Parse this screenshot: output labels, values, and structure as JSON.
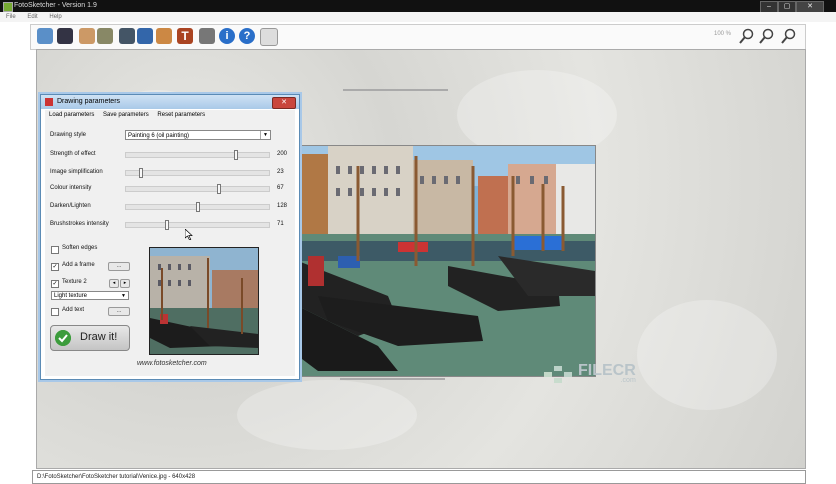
{
  "window": {
    "title": "FotoSketcher - Version 1.9",
    "min": "–",
    "max": "▢",
    "close": "✕"
  },
  "menu": [
    "File",
    "Edit",
    "Help"
  ],
  "toolbar": {
    "zoom": "100 %"
  },
  "dialog": {
    "title": "Drawing parameters",
    "close": "✕",
    "menu": [
      "Load parameters",
      "Save parameters",
      "Reset parameters"
    ],
    "style_label": "Drawing style",
    "style_value": "Painting 6 (oil painting)",
    "sliders": [
      {
        "label": "Strength of effect",
        "value": "200",
        "pos": 0.77
      },
      {
        "label": "Image simplification",
        "value": "23",
        "pos": 0.09
      },
      {
        "label": "Colour intensity",
        "value": "67",
        "pos": 0.65
      },
      {
        "label": "Darken/Lighten",
        "value": "128",
        "pos": 0.5
      },
      {
        "label": "Brushstrokes intensity",
        "value": "71",
        "pos": 0.28
      }
    ],
    "soften_edges": "Soften edges",
    "add_frame": "Add a frame",
    "texture": "Texture 2",
    "texture_value": "Light texture",
    "add_text": "Add text",
    "draw_button": "Draw it!",
    "website": "www.fotosketcher.com"
  },
  "watermark": {
    "brand": "FILECR",
    "tld": ".com"
  },
  "status": "D:\\FotoSketcher\\FotoSketcher tutorial\\Venice.jpg - 640x428"
}
